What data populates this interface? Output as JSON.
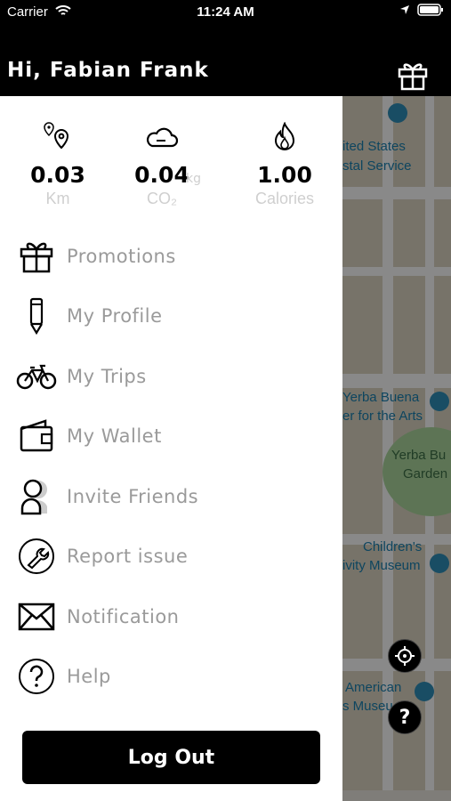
{
  "status_bar": {
    "carrier": "Carrier",
    "time": "11:24 AM"
  },
  "header": {
    "greeting": "Hi, Fabian Frank"
  },
  "stats": [
    {
      "value": "0.03",
      "unit": "",
      "label": "Km",
      "icon": "location-pins-icon"
    },
    {
      "value": "0.04",
      "unit": "kg",
      "label": "CO₂",
      "icon": "cloud-icon"
    },
    {
      "value": "1.00",
      "unit": "",
      "label": "Calories",
      "icon": "flame-icon"
    }
  ],
  "menu": [
    {
      "label": "Promotions",
      "icon": "gift-icon"
    },
    {
      "label": "My Profile",
      "icon": "pencil-icon"
    },
    {
      "label": "My Trips",
      "icon": "bicycle-icon"
    },
    {
      "label": "My Wallet",
      "icon": "wallet-icon"
    },
    {
      "label": "Invite Friends",
      "icon": "friends-icon"
    },
    {
      "label": "Report issue",
      "icon": "wrench-icon"
    },
    {
      "label": "Notification",
      "icon": "envelope-icon"
    },
    {
      "label": "Help",
      "icon": "question-icon"
    }
  ],
  "logout_label": "Log Out",
  "map": {
    "labels": [
      "ited States",
      "stal Service",
      "Yerba Buena",
      "er for the Arts",
      "Yerba Bu",
      "Garden",
      "Children's",
      "ivity Museum",
      "American",
      "s Museu"
    ]
  },
  "colors": {
    "accent": "#000000",
    "muted_text": "#9a9a9a",
    "map_label": "#1a7fae"
  }
}
